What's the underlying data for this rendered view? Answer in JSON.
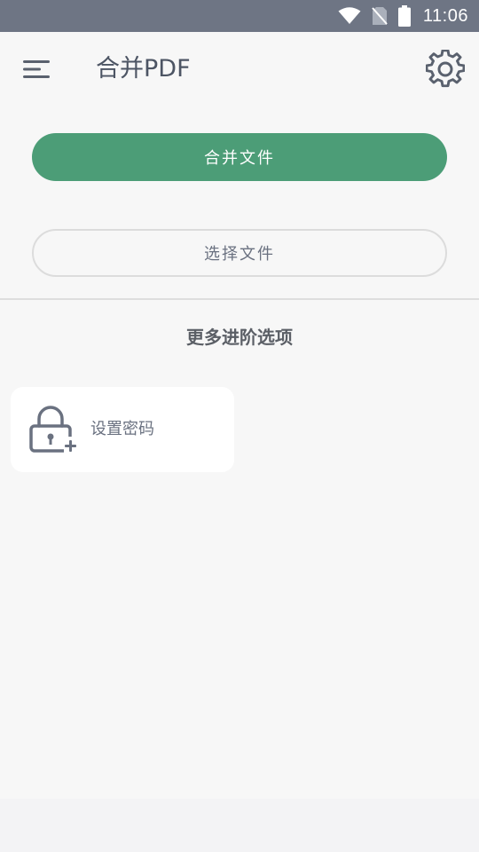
{
  "status_bar": {
    "time": "11:06",
    "icons": [
      "wifi-icon",
      "no-sim-icon",
      "battery-icon"
    ],
    "background": "#6e7584"
  },
  "app_bar": {
    "title": "合并PDF",
    "menu_icon": "menu-icon",
    "settings_icon": "gear-icon"
  },
  "main": {
    "merge_button_label": "合并文件",
    "select_button_label": "选择文件",
    "advanced_section_title": "更多进阶选项",
    "options": [
      {
        "label": "设置密码",
        "icon": "lock-plus-icon"
      }
    ]
  },
  "colors": {
    "accent": "#4c9d77",
    "text_primary": "#4d5564",
    "text_secondary": "#6a7180",
    "background": "#f7f7f7"
  }
}
